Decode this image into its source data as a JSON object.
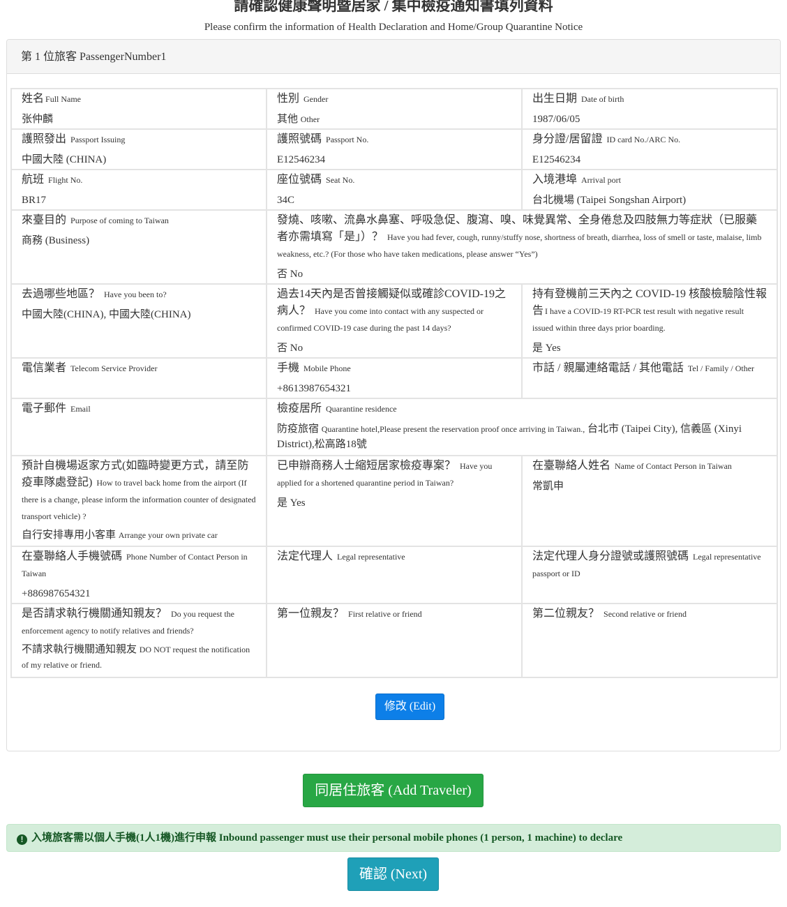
{
  "page": {
    "title": "請確認健康聲明暨居家 / 集中檢疫通知書填列資料",
    "subtitle": "Please confirm the information of Health Declaration and Home/Group Quarantine Notice"
  },
  "panel": {
    "heading": "第 1 位旅客 PassengerNumber1"
  },
  "fields": {
    "full_name": {
      "zh": "姓名",
      "en": "Full Name",
      "value": "张仲麟"
    },
    "gender": {
      "zh": "性別",
      "en": "Gender",
      "value_zh": "其他",
      "value_en": "Other"
    },
    "dob": {
      "zh": "出生日期",
      "en": "Date of birth",
      "value": "1987/06/05"
    },
    "passport_issuing": {
      "zh": "護照發出",
      "en": "Passport Issuing",
      "value": "中國大陸 (CHINA)"
    },
    "passport_no": {
      "zh": "護照號碼",
      "en": "Passport No.",
      "value": "E12546234"
    },
    "id_card": {
      "zh": "身分證/居留證",
      "en": "ID card No./ARC No.",
      "value": "E12546234"
    },
    "flight_no": {
      "zh": "航班",
      "en": "Flight No.",
      "value": "BR17"
    },
    "seat_no": {
      "zh": "座位號碼",
      "en": "Seat No.",
      "value": "34C"
    },
    "arrival_port": {
      "zh": "入境港埠",
      "en": "Arrival port",
      "value": "台北機場 (Taipei Songshan Airport)"
    },
    "purpose": {
      "zh": "來臺目的",
      "en": "Purpose of coming to Taiwan",
      "value": "商務 (Business)"
    },
    "symptoms": {
      "zh": "發燒、咳嗽、流鼻水鼻塞、呼吸急促、腹瀉、嗅、味覺異常、全身倦怠及四肢無力等症狀（已服藥者亦需填寫「是」）？",
      "en": "Have you had fever, cough, runny/stuffy nose, shortness of breath, diarrhea, loss of smell or taste, malaise, limb weakness, etc.? (For those who have taken medications, please answer “Yes”)",
      "value": "否 No"
    },
    "been_to": {
      "zh": "去過哪些地區？",
      "en": "Have you been to?",
      "value": "中國大陸(CHINA), 中國大陸(CHINA)"
    },
    "contact": {
      "zh": "過去14天內是否曾接觸疑似或確診COVID-19之病人？",
      "en": "Have you come into contact with any suspected or confirmed COVID-19 case during the past 14 days?",
      "value": "否 No"
    },
    "pcr": {
      "zh": "持有登機前三天內之 COVID-19 核酸檢驗陰性報告",
      "en": "I have a COVID-19 RT-PCR test result with negative result issued within three days prior boarding.",
      "value": "是 Yes"
    },
    "telecom": {
      "zh": "電信業者",
      "en": "Telecom Service Provider",
      "value": ""
    },
    "mobile": {
      "zh": "手機",
      "en": "Mobile Phone",
      "value": "+8613987654321"
    },
    "tel": {
      "zh": "市話 / 親屬連絡電話 / 其他電話",
      "en": "Tel / Family / Other",
      "value": ""
    },
    "email": {
      "zh": "電子郵件",
      "en": "Email",
      "value": ""
    },
    "quarantine": {
      "zh": "檢疫居所",
      "en": "Quarantine residence",
      "value_zh": "防疫旅宿",
      "value_en": "Quarantine hotel,Please present the reservation proof once arriving in Taiwan.,",
      "value_tail": "台北市 (Taipei City), 信義區 (Xinyi District),松高路18號"
    },
    "transport": {
      "zh": "預計自機場返家方式(如臨時變更方式，請至防疫車隊處登記)",
      "en": "How to travel back home from the airport (If there is a change, please inform the information counter of designated transport vehicle) ?",
      "value_zh": "自行安排專用小客車",
      "value_en": "Arrange your own private car"
    },
    "shortened": {
      "zh": "已申辦商務人士縮短居家檢疫專案？",
      "en": "Have you applied for a shortened quarantine period in Taiwan?",
      "value": "是 Yes"
    },
    "contact_name": {
      "zh": "在臺聯絡人姓名",
      "en": "Name of Contact Person in Taiwan",
      "value": "常凱申"
    },
    "contact_phone": {
      "zh": "在臺聯絡人手機號碼",
      "en": "Phone Number of Contact Person in Taiwan",
      "value": "+886987654321"
    },
    "legal_rep": {
      "zh": "法定代理人",
      "en": "Legal representative",
      "value": ""
    },
    "legal_rep_id": {
      "zh": "法定代理人身分證號或護照號碼",
      "en": "Legal representative passport or ID",
      "value": ""
    },
    "notify": {
      "zh": "是否請求執行機關通知親友？",
      "en": "Do you request the enforcement agency to notify relatives and friends?",
      "value_zh": "不請求執行機關通知親友",
      "value_en": "DO NOT request the notification of my relative or friend."
    },
    "relative1": {
      "zh": "第一位親友？",
      "en": "First relative or friend",
      "value": ""
    },
    "relative2": {
      "zh": "第二位親友？",
      "en": "Second relative or friend",
      "value": ""
    }
  },
  "buttons": {
    "edit": "修改 (Edit)",
    "add_traveler": "同居住旅客 (Add Traveler)",
    "next": "確認 (Next)"
  },
  "alert": {
    "icon": "exclamation-circle-icon",
    "text": "入境旅客需以個人手機(1人1機)進行申報 Inbound passenger must use their personal mobile phones (1 person, 1 machine) to declare"
  },
  "colors": {
    "edit_button": "#0d7fe8",
    "add_button": "#28a745",
    "next_button": "#1fa0b8",
    "alert_bg": "#d4edda",
    "alert_text": "#155724"
  }
}
